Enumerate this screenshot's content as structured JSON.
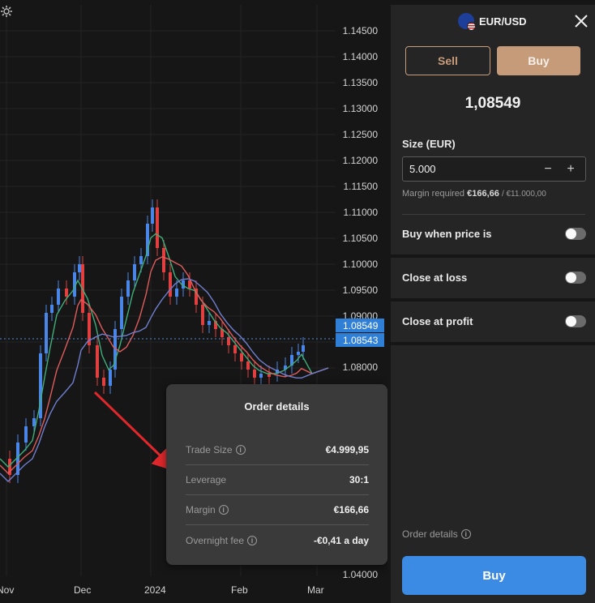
{
  "chart": {
    "y_axis_labels": [
      "1.14500",
      "1.14000",
      "1.13500",
      "1.13000",
      "1.12500",
      "1.12000",
      "1.11500",
      "1.11000",
      "1.10500",
      "1.10000",
      "1.09500",
      "1.09000",
      "1.08000",
      "1.04000"
    ],
    "x_axis_labels": [
      "Nov",
      "Dec",
      "2024",
      "Feb",
      "Mar"
    ],
    "price_tags": [
      "1.08549",
      "1.08543"
    ],
    "colors": {
      "up": "#4a86e8",
      "down": "#e0403f",
      "ma_green": "#3fae79",
      "ma_red": "#e05c5c",
      "ma_blue": "#6f7fd0",
      "arrow": "#e0282c"
    }
  },
  "order_popup": {
    "title": "Order details",
    "rows": [
      {
        "label": "Trade Size",
        "value": "€4.999,95",
        "info": true
      },
      {
        "label": "Leverage",
        "value": "30:1",
        "info": false
      },
      {
        "label": "Margin",
        "value": "€166,66",
        "info": true
      },
      {
        "label": "Overnight fee",
        "value": "-€0,41 a day",
        "info": true
      }
    ]
  },
  "panel": {
    "pair": "EUR/USD",
    "sell_label": "Sell",
    "buy_tab_label": "Buy",
    "price": "1,08549",
    "size_label": "Size (EUR)",
    "size_value": "5.000",
    "minus": "−",
    "plus": "+",
    "margin_label": "Margin required",
    "margin_value": "€166,66",
    "margin_total": "/ €11.000,00",
    "buy_when_label": "Buy when price is",
    "close_loss_label": "Close at loss",
    "close_profit_label": "Close at profit",
    "order_details_link": "Order details",
    "buy_button": "Buy",
    "accent": "#c69b79",
    "buy_color": "#3b8ae4"
  }
}
